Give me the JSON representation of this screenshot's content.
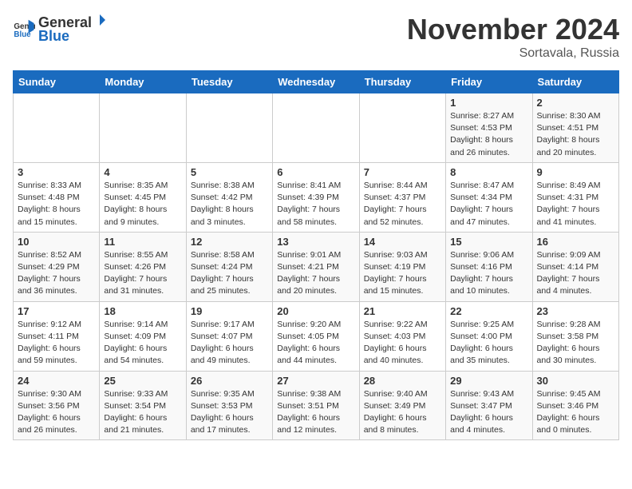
{
  "header": {
    "logo_general": "General",
    "logo_blue": "Blue",
    "month_title": "November 2024",
    "location": "Sortavala, Russia"
  },
  "days_of_week": [
    "Sunday",
    "Monday",
    "Tuesday",
    "Wednesday",
    "Thursday",
    "Friday",
    "Saturday"
  ],
  "weeks": [
    [
      {
        "day": "",
        "info": ""
      },
      {
        "day": "",
        "info": ""
      },
      {
        "day": "",
        "info": ""
      },
      {
        "day": "",
        "info": ""
      },
      {
        "day": "",
        "info": ""
      },
      {
        "day": "1",
        "info": "Sunrise: 8:27 AM\nSunset: 4:53 PM\nDaylight: 8 hours and 26 minutes."
      },
      {
        "day": "2",
        "info": "Sunrise: 8:30 AM\nSunset: 4:51 PM\nDaylight: 8 hours and 20 minutes."
      }
    ],
    [
      {
        "day": "3",
        "info": "Sunrise: 8:33 AM\nSunset: 4:48 PM\nDaylight: 8 hours and 15 minutes."
      },
      {
        "day": "4",
        "info": "Sunrise: 8:35 AM\nSunset: 4:45 PM\nDaylight: 8 hours and 9 minutes."
      },
      {
        "day": "5",
        "info": "Sunrise: 8:38 AM\nSunset: 4:42 PM\nDaylight: 8 hours and 3 minutes."
      },
      {
        "day": "6",
        "info": "Sunrise: 8:41 AM\nSunset: 4:39 PM\nDaylight: 7 hours and 58 minutes."
      },
      {
        "day": "7",
        "info": "Sunrise: 8:44 AM\nSunset: 4:37 PM\nDaylight: 7 hours and 52 minutes."
      },
      {
        "day": "8",
        "info": "Sunrise: 8:47 AM\nSunset: 4:34 PM\nDaylight: 7 hours and 47 minutes."
      },
      {
        "day": "9",
        "info": "Sunrise: 8:49 AM\nSunset: 4:31 PM\nDaylight: 7 hours and 41 minutes."
      }
    ],
    [
      {
        "day": "10",
        "info": "Sunrise: 8:52 AM\nSunset: 4:29 PM\nDaylight: 7 hours and 36 minutes."
      },
      {
        "day": "11",
        "info": "Sunrise: 8:55 AM\nSunset: 4:26 PM\nDaylight: 7 hours and 31 minutes."
      },
      {
        "day": "12",
        "info": "Sunrise: 8:58 AM\nSunset: 4:24 PM\nDaylight: 7 hours and 25 minutes."
      },
      {
        "day": "13",
        "info": "Sunrise: 9:01 AM\nSunset: 4:21 PM\nDaylight: 7 hours and 20 minutes."
      },
      {
        "day": "14",
        "info": "Sunrise: 9:03 AM\nSunset: 4:19 PM\nDaylight: 7 hours and 15 minutes."
      },
      {
        "day": "15",
        "info": "Sunrise: 9:06 AM\nSunset: 4:16 PM\nDaylight: 7 hours and 10 minutes."
      },
      {
        "day": "16",
        "info": "Sunrise: 9:09 AM\nSunset: 4:14 PM\nDaylight: 7 hours and 4 minutes."
      }
    ],
    [
      {
        "day": "17",
        "info": "Sunrise: 9:12 AM\nSunset: 4:11 PM\nDaylight: 6 hours and 59 minutes."
      },
      {
        "day": "18",
        "info": "Sunrise: 9:14 AM\nSunset: 4:09 PM\nDaylight: 6 hours and 54 minutes."
      },
      {
        "day": "19",
        "info": "Sunrise: 9:17 AM\nSunset: 4:07 PM\nDaylight: 6 hours and 49 minutes."
      },
      {
        "day": "20",
        "info": "Sunrise: 9:20 AM\nSunset: 4:05 PM\nDaylight: 6 hours and 44 minutes."
      },
      {
        "day": "21",
        "info": "Sunrise: 9:22 AM\nSunset: 4:03 PM\nDaylight: 6 hours and 40 minutes."
      },
      {
        "day": "22",
        "info": "Sunrise: 9:25 AM\nSunset: 4:00 PM\nDaylight: 6 hours and 35 minutes."
      },
      {
        "day": "23",
        "info": "Sunrise: 9:28 AM\nSunset: 3:58 PM\nDaylight: 6 hours and 30 minutes."
      }
    ],
    [
      {
        "day": "24",
        "info": "Sunrise: 9:30 AM\nSunset: 3:56 PM\nDaylight: 6 hours and 26 minutes."
      },
      {
        "day": "25",
        "info": "Sunrise: 9:33 AM\nSunset: 3:54 PM\nDaylight: 6 hours and 21 minutes."
      },
      {
        "day": "26",
        "info": "Sunrise: 9:35 AM\nSunset: 3:53 PM\nDaylight: 6 hours and 17 minutes."
      },
      {
        "day": "27",
        "info": "Sunrise: 9:38 AM\nSunset: 3:51 PM\nDaylight: 6 hours and 12 minutes."
      },
      {
        "day": "28",
        "info": "Sunrise: 9:40 AM\nSunset: 3:49 PM\nDaylight: 6 hours and 8 minutes."
      },
      {
        "day": "29",
        "info": "Sunrise: 9:43 AM\nSunset: 3:47 PM\nDaylight: 6 hours and 4 minutes."
      },
      {
        "day": "30",
        "info": "Sunrise: 9:45 AM\nSunset: 3:46 PM\nDaylight: 6 hours and 0 minutes."
      }
    ]
  ]
}
